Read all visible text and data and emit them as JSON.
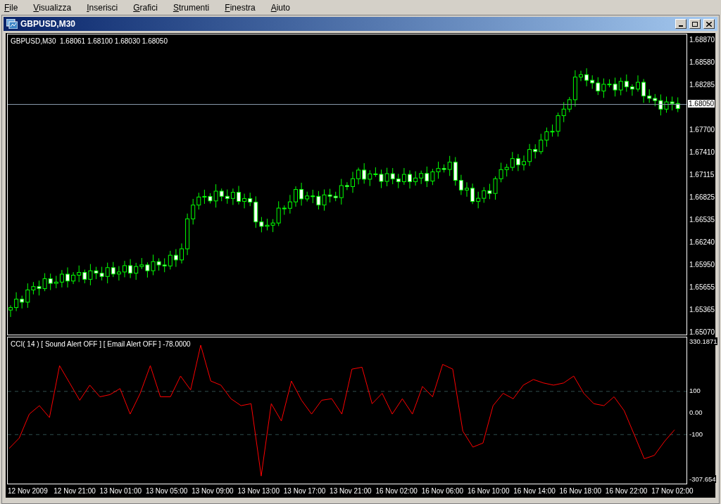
{
  "menu": [
    {
      "label": "File"
    },
    {
      "label": "Visualizza"
    },
    {
      "label": "Inserisci"
    },
    {
      "label": "Grafici"
    },
    {
      "label": "Strumenti"
    },
    {
      "label": "Finestra"
    },
    {
      "label": "Aiuto"
    }
  ],
  "window": {
    "title": "GBPUSD,M30"
  },
  "price_chart": {
    "legend": "GBPUSD,M30  1.68061 1.68100 1.68030 1.68050",
    "current_price": "1.68050",
    "price_axis": [
      "1.68870",
      "1.68580",
      "1.68285",
      "1.67700",
      "1.67410",
      "1.67115",
      "1.66825",
      "1.66535",
      "1.66240",
      "1.65950",
      "1.65655",
      "1.65365",
      "1.65070"
    ]
  },
  "indicator": {
    "legend": "CCI( 14 ) [ Sound Alert OFF ] [ Email Alert OFF ] -78.0000",
    "chart_data": {
      "type": "line",
      "series": [
        {
          "color": "#ff0000",
          "values": [
            -164,
            -116,
            -5,
            34,
            -21,
            219,
            139,
            59,
            129,
            75,
            85,
            113,
            -5,
            91,
            219,
            75,
            75,
            171,
            107,
            314,
            148,
            129,
            66,
            34,
            43,
            -292,
            43,
            -37,
            148,
            59,
            -5,
            59,
            66,
            -5,
            203,
            212,
            43,
            91,
            -5,
            66,
            -5,
            123,
            75,
            225,
            203,
            -84,
            -158,
            -139,
            34,
            91,
            66,
            129,
            155,
            139,
            129,
            139,
            171,
            91,
            43,
            34,
            75,
            11,
            -100,
            -212,
            -196,
            -132,
            -78
          ]
        }
      ],
      "ylim": [
        -327,
        350
      ],
      "yticks": [
        {
          "value": 330.1871,
          "label": "330.1871"
        },
        {
          "value": 100,
          "label": "100"
        },
        {
          "value": 0,
          "label": "0.00"
        },
        {
          "value": -100,
          "label": "-100"
        },
        {
          "value": -307.654,
          "label": "-307.654"
        }
      ]
    }
  },
  "time_axis": [
    "12 Nov 2009",
    "12 Nov 21:00",
    "13 Nov 01:00",
    "13 Nov 05:00",
    "13 Nov 09:00",
    "13 Nov 13:00",
    "13 Nov 17:00",
    "13 Nov 21:00",
    "16 Nov 02:00",
    "16 Nov 06:00",
    "16 Nov 10:00",
    "16 Nov 14:00",
    "16 Nov 18:00",
    "16 Nov 22:00",
    "17 Nov 02:00"
  ]
}
